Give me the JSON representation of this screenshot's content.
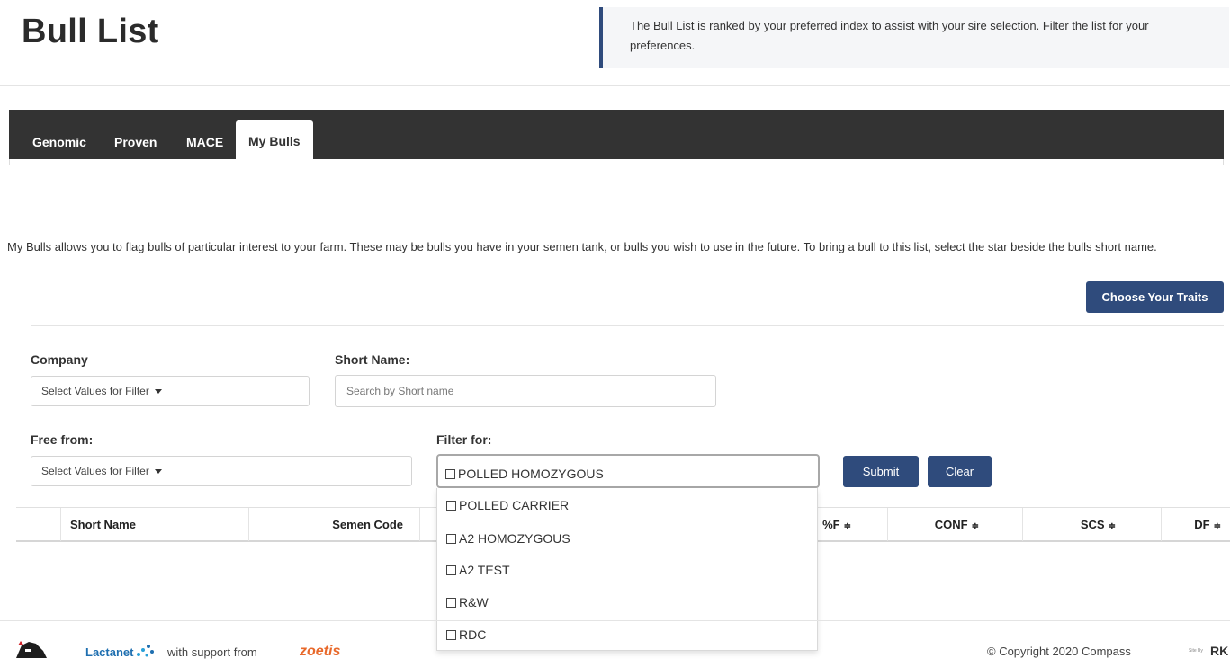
{
  "header": {
    "title": "Bull List",
    "intro": "The Bull List is ranked by your preferred index to assist with your sire selection. Filter the list for your preferences."
  },
  "tabs": [
    {
      "label": "Genomic",
      "active": false
    },
    {
      "label": "Proven",
      "active": false
    },
    {
      "label": "MACE",
      "active": false
    },
    {
      "label": "My Bulls",
      "active": true
    }
  ],
  "description": "My Bulls allows you to flag bulls of particular interest to your farm. These may be bulls you have in your semen tank, or bulls you wish to use in the future. To bring a bull to this list, select the star beside the bulls short name.",
  "actions": {
    "choose_traits": "Choose Your Traits"
  },
  "filters": {
    "company": {
      "label": "Company",
      "value": "Select Values for Filter"
    },
    "short_name": {
      "label": "Short Name:",
      "placeholder": "Search by Short name"
    },
    "free_from": {
      "label": "Free from:",
      "value": "Select Values for Filter"
    },
    "filter_for": {
      "label": "Filter for:",
      "options": [
        "POLLED HOMOZYGOUS",
        "POLLED CARRIER",
        "A2 HOMOZYGOUS",
        "A2 TEST",
        "R&W",
        "RDC"
      ]
    },
    "submit": "Submit",
    "clear": "Clear"
  },
  "table": {
    "columns": [
      "Short Name",
      "Semen Code",
      "%F",
      "CONF",
      "SCS",
      "DF"
    ],
    "sort_glyph": "≑"
  },
  "footer": {
    "lactanet": "Lactanet",
    "support_text": "with support from",
    "zoetis": "zoetis",
    "copyright": "© Copyright 2020 Compass",
    "site_by": "Site By",
    "rk": "RK"
  },
  "colors": {
    "primary_button": "#2f4b7c",
    "tabbar": "#333333",
    "zoetis": "#e8692b",
    "lactanet": "#1f6fb0"
  }
}
